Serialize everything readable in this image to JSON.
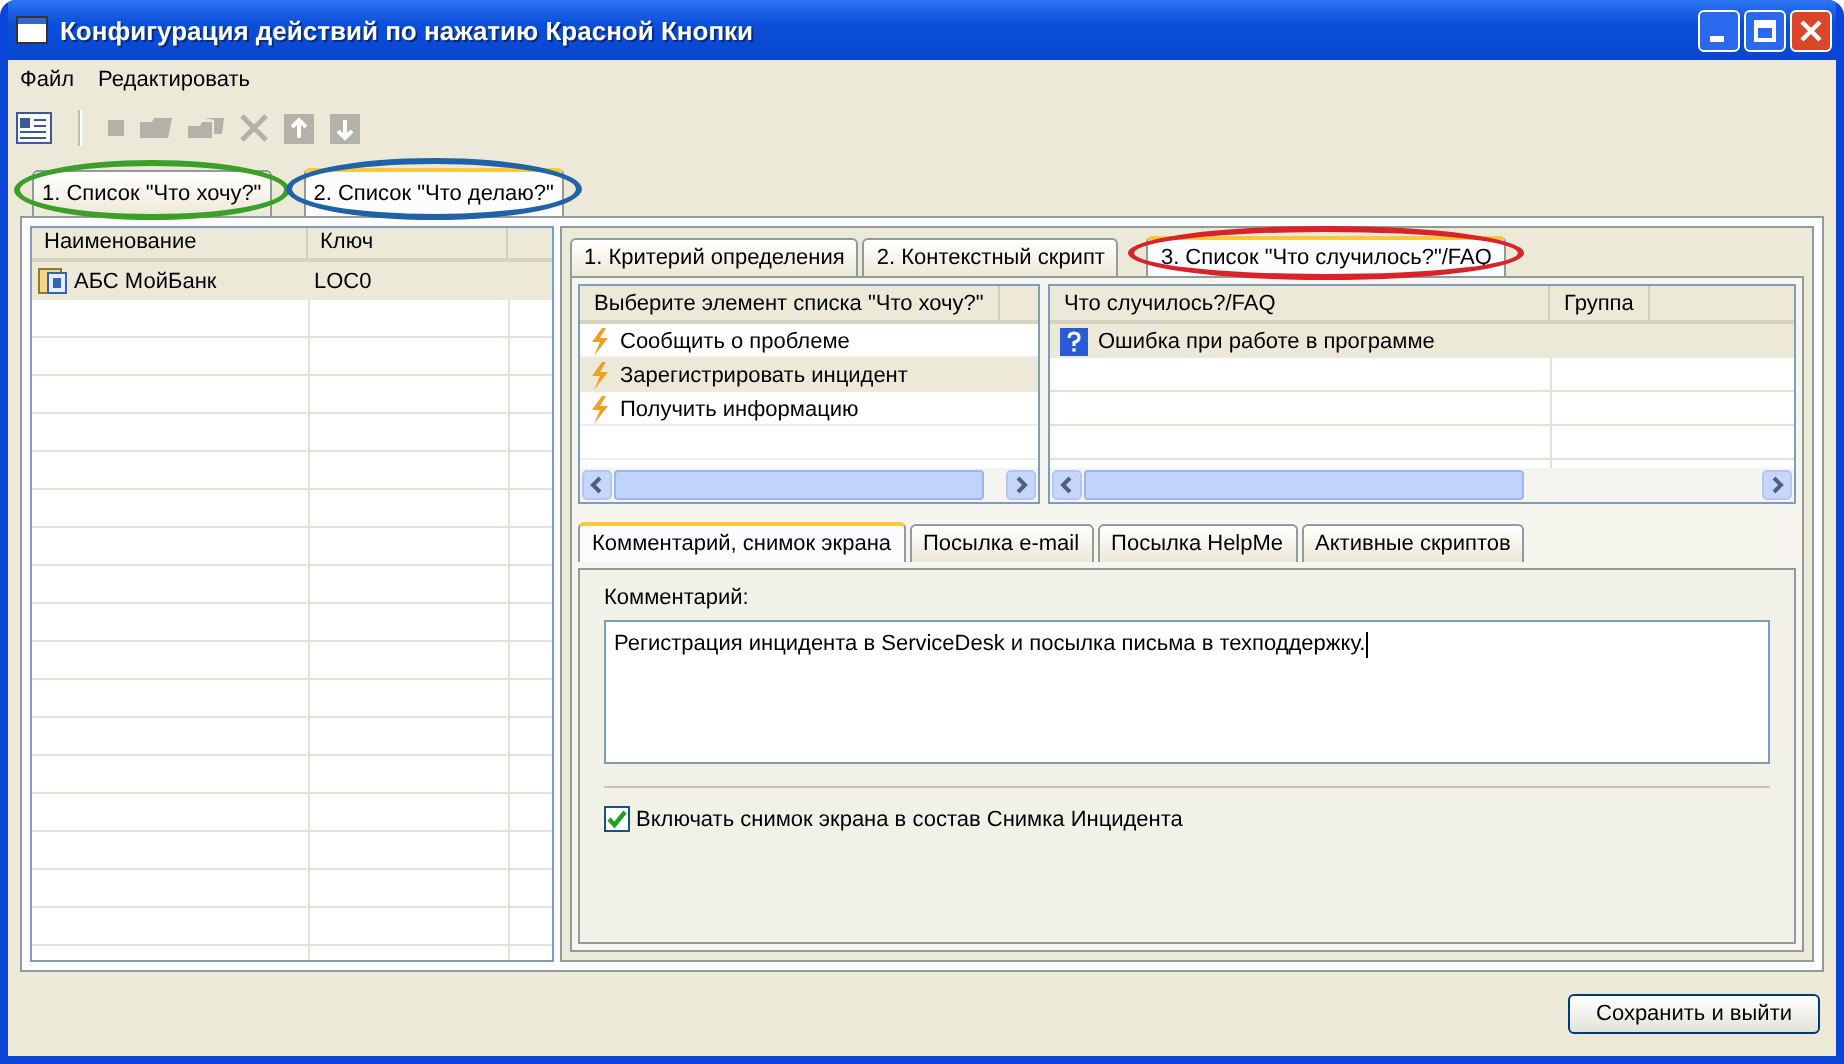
{
  "window": {
    "title": "Конфигурация действий по нажатию Красной Кнопки"
  },
  "menu": [
    "Файл",
    "Редактировать"
  ],
  "toolbar": [
    {
      "kind": "document",
      "disabled": false
    },
    {
      "kind": "square",
      "disabled": true
    },
    {
      "kind": "folder",
      "disabled": true
    },
    {
      "kind": "folders",
      "disabled": true
    },
    {
      "kind": "cross",
      "disabled": true
    },
    {
      "kind": "up",
      "disabled": true
    },
    {
      "kind": "down",
      "disabled": true
    }
  ],
  "outer_tabs": [
    {
      "label": "1. Список \"Что хочу?\"",
      "selected": false,
      "color": "#3aa028"
    },
    {
      "label": "2. Список \"Что делаю?\"",
      "selected": true,
      "color": "#1f63a6"
    }
  ],
  "left_table": {
    "columns": [
      "Наименование",
      "Ключ"
    ],
    "rows": [
      {
        "name": "АБС МойБанк",
        "key": "LOC0",
        "selected": true
      }
    ]
  },
  "inner_tabs": [
    {
      "label": "1. Критерий определения",
      "selected": false
    },
    {
      "label": "2. Контекстный скрипт",
      "selected": false
    },
    {
      "label": "3. Список \"Что случилось?\"/FAQ",
      "selected": true,
      "color": "#d8232a"
    }
  ],
  "want_list": {
    "header": "Выберите элемент списка \"Что хочу?\"",
    "items": [
      {
        "label": "Сообщить о проблеме",
        "selected": false
      },
      {
        "label": "Зарегистрировать инцидент",
        "selected": true
      },
      {
        "label": "Получить информацию",
        "selected": false
      }
    ]
  },
  "faq_table": {
    "columns": [
      "Что случилось?/FAQ",
      "Группа"
    ],
    "rows": [
      {
        "label": "Ошибка при работе в программе",
        "selected": true
      }
    ]
  },
  "detail_tabs": [
    {
      "label": "Комментарий, снимок экрана",
      "selected": true
    },
    {
      "label": "Посылка e-mail",
      "selected": false
    },
    {
      "label": "Посылка HelpMe",
      "selected": false
    },
    {
      "label": "Активные скриптов",
      "selected": false
    }
  ],
  "comment": {
    "label": "Комментарий:",
    "value": "Регистрация инцидента в ServiceDesk и посылка письма в техподдержку."
  },
  "screenshot_option": {
    "label": "Включать снимок экрана в состав Снимка Инцидента",
    "checked": true
  },
  "buttons": [
    "Сохранить и выйти"
  ]
}
